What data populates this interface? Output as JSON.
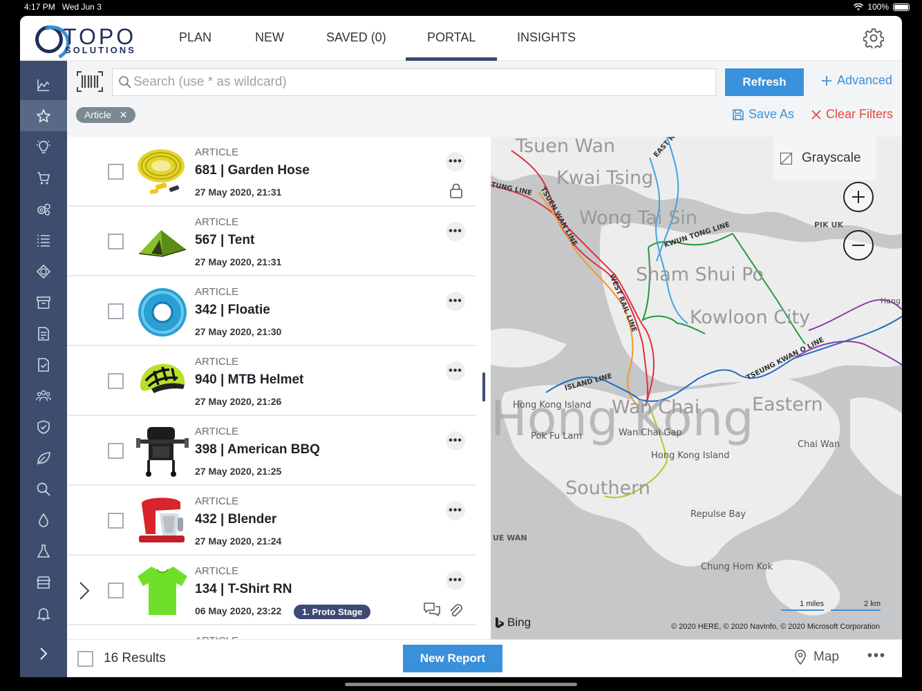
{
  "status": {
    "time": "4:17 PM",
    "date": "Wed Jun 3",
    "battery": "100%"
  },
  "brand": {
    "name_top": "TOPO",
    "name_bottom": "SOLUTIONS"
  },
  "nav": {
    "items": [
      "PLAN",
      "NEW",
      "SAVED (0)",
      "PORTAL",
      "INSIGHTS"
    ],
    "active": "PORTAL"
  },
  "sidebar": {
    "icons": [
      "chart-icon",
      "star-icon",
      "lightbulb-icon",
      "cart-icon",
      "gears-icon",
      "list-icon",
      "shape-icon",
      "archive-icon",
      "document-icon",
      "document-check-icon",
      "people-icon",
      "shield-check-icon",
      "leaf-icon",
      "search-icon",
      "drop-icon",
      "flask-icon",
      "store-icon",
      "bell-icon"
    ],
    "active": "star-icon"
  },
  "toolbar": {
    "search_placeholder": "Search (use * as wildcard)",
    "refresh_label": "Refresh",
    "advanced_label": "Advanced",
    "chip_label": "Article",
    "saveas_label": "Save As",
    "clear_label": "Clear Filters"
  },
  "items": [
    {
      "type": "ARTICLE",
      "title": "681 | Garden Hose",
      "date": "27 May 2020, 21:31",
      "lock": true
    },
    {
      "type": "ARTICLE",
      "title": "567 | Tent",
      "date": "27 May 2020, 21:31"
    },
    {
      "type": "ARTICLE",
      "title": "342 | Floatie",
      "date": "27 May 2020, 21:30"
    },
    {
      "type": "ARTICLE",
      "title": "940 | MTB Helmet",
      "date": "27 May 2020, 21:26"
    },
    {
      "type": "ARTICLE",
      "title": "398 | American BBQ",
      "date": "27 May 2020, 21:25"
    },
    {
      "type": "ARTICLE",
      "title": "432 | Blender",
      "date": "27 May 2020, 21:24"
    },
    {
      "type": "ARTICLE",
      "title": "134 | T-Shirt RN",
      "date": "06 May 2020, 23:22",
      "stage": "1. Proto Stage"
    },
    {
      "type": "ARTICLE"
    }
  ],
  "map": {
    "grayscale_label": "Grayscale",
    "labels": [
      "Tsuen Wan",
      "Kwai Tsing",
      "Wong Tai Sin",
      "Sham Shui Po",
      "Kowloon City",
      "Hong Kong",
      "Wan Chai",
      "Eastern",
      "Southern",
      "Hong Kong Island",
      "Pok Fu Lam",
      "Wan Chai Gap",
      "Hong Kong Island",
      "Chai Wan",
      "Repulse Bay",
      "Chung Hom Kok",
      "PIK UK",
      "UE WAN",
      "Hang"
    ],
    "lines": [
      "EAST RAIL",
      "TSUEN WAN LINE",
      "KWUN TONG LINE",
      "WEST RAIL LINE",
      "ISLAND LINE",
      "TSEUNG KWAN O LINE",
      "TUNG LINE"
    ],
    "bing": "Bing",
    "copyright": "© 2020 HERE, © 2020 NavInfo, © 2020 Microsoft Corporation",
    "scale_miles": "1 miles",
    "scale_km": "2 km"
  },
  "footer": {
    "results": "16 Results",
    "new_report": "New Report",
    "map_label": "Map"
  }
}
